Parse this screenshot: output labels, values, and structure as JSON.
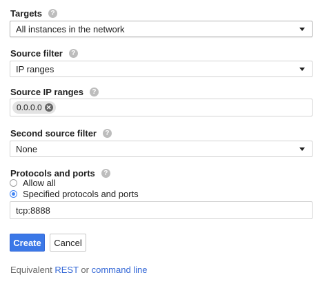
{
  "targets": {
    "label": "Targets",
    "help": "?",
    "value": "All instances in the network"
  },
  "source_filter": {
    "label": "Source filter",
    "help": "?",
    "value": "IP ranges"
  },
  "source_ip_ranges": {
    "label": "Source IP ranges",
    "help": "?",
    "chips": [
      "0.0.0.0"
    ]
  },
  "second_source_filter": {
    "label": "Second source filter",
    "help": "?",
    "value": "None"
  },
  "protocols": {
    "label": "Protocols and ports",
    "help": "?",
    "options": [
      "Allow all",
      "Specified protocols and ports"
    ],
    "selected": "Specified protocols and ports",
    "value": "tcp:8888"
  },
  "buttons": {
    "create": "Create",
    "cancel": "Cancel"
  },
  "footer": {
    "prefix": "Equivalent",
    "rest": "REST",
    "or": "or",
    "command_line": "command line"
  },
  "colors": {
    "accent": "#3b78e7",
    "link": "#3367d6"
  }
}
